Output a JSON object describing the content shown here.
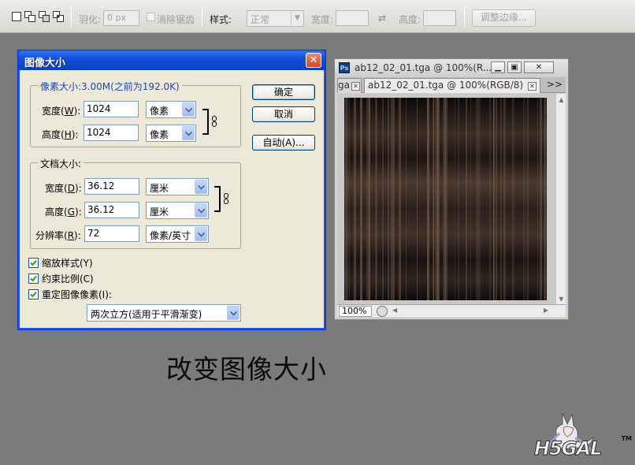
{
  "options_bar": {
    "feather_label": "羽化:",
    "feather_value": "0 px",
    "antialias_label": "消除锯齿",
    "style_label": "样式:",
    "style_value": "正常",
    "width_label": "宽度:",
    "height_label": "高度:",
    "refine_edge_label": "调整边缘..."
  },
  "dialog": {
    "title": "图像大小",
    "pixel_dimensions": {
      "group_title": "像素大小:3.00M(之前为192.0K)",
      "width_label": "宽度",
      "width_key": "W",
      "width_value": "1024",
      "width_unit": "像素",
      "height_label": "高度",
      "height_key": "H",
      "height_value": "1024",
      "height_unit": "像素"
    },
    "document_size": {
      "group_title": "文档大小:",
      "width_label": "宽度",
      "width_key": "D",
      "width_value": "36.12",
      "width_unit": "厘米",
      "height_label": "高度",
      "height_key": "G",
      "height_value": "36.12",
      "height_unit": "厘米",
      "resolution_label": "分辨率",
      "resolution_key": "R",
      "resolution_value": "72",
      "resolution_unit": "像素/英寸"
    },
    "buttons": {
      "ok": "确定",
      "cancel": "取消",
      "auto": "自动(A)..."
    },
    "checkboxes": {
      "scale_styles": "缩放样式(Y)",
      "constrain_proportions": "约束比例(C)",
      "resample_image": "重定图像像素(I):"
    },
    "resample_method": "两次立方(适用于平滑渐变)"
  },
  "document_window": {
    "title": "ab12_02_01.tga @ 100%(R...",
    "tab_partial": "ga",
    "tab_active": "ab12_02_01.tga @ 100%(RGB/8)",
    "tab_more": ">>",
    "zoom": "100%"
  },
  "caption": "改变图像大小",
  "logo": {
    "text": "H5GAL",
    "tm": "TM"
  }
}
